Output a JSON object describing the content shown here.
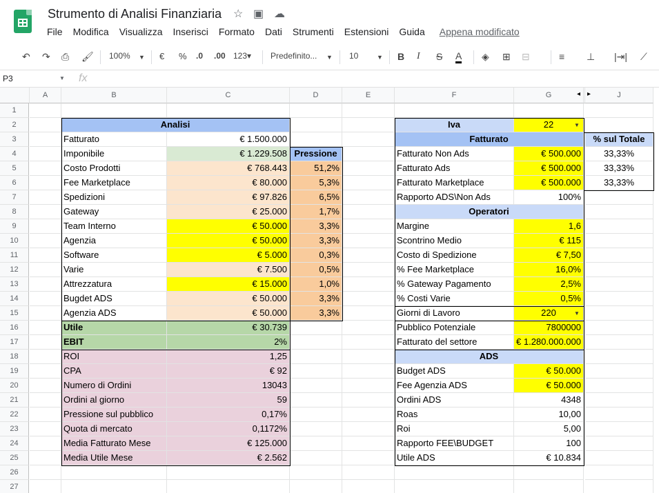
{
  "app": {
    "title": "Strumento di Analisi Finanziaria",
    "last_edit": "Appena modificato"
  },
  "menu": [
    "File",
    "Modifica",
    "Visualizza",
    "Inserisci",
    "Formato",
    "Dati",
    "Strumenti",
    "Estensioni",
    "Guida"
  ],
  "toolbar": {
    "zoom": "100%",
    "currency": "€",
    "percent": "%",
    "dec_decimal": ".0",
    "inc_decimal": ".00",
    "more_formats": "123▾",
    "font": "Predefinito...",
    "font_size": "10"
  },
  "formula": {
    "cell_ref": "P3"
  },
  "colors": {
    "header_blue": "#a4c2f4",
    "light_green": "#d9ead3",
    "green": "#b6d7a8",
    "peach": "#fce5cd",
    "orange": "#f9cb9c",
    "yellow": "#ffff00",
    "pink": "#ead1dc"
  },
  "columns": [
    "A",
    "B",
    "C",
    "D",
    "E",
    "F",
    "G",
    "H",
    "J"
  ],
  "rows": [
    {
      "n": 1,
      "cells": []
    },
    {
      "n": 2,
      "cells": [
        {
          "c": "B",
          "span": 2,
          "v": "Analisi",
          "a": "c",
          "b": true,
          "bg": "#a4c2f4"
        },
        {
          "c": "F",
          "v": "Iva",
          "a": "c",
          "b": true,
          "bg": "#c9daf8"
        },
        {
          "c": "G",
          "v": "22",
          "a": "c",
          "bg": "#ffff00",
          "dd": true
        }
      ]
    },
    {
      "n": 3,
      "cells": [
        {
          "c": "B",
          "v": "Fatturato"
        },
        {
          "c": "C",
          "v": "€ 1.500.000",
          "a": "r"
        },
        {
          "c": "F",
          "span": 2,
          "v": "Fatturato",
          "a": "c",
          "b": true,
          "bg": "#a4c2f4"
        },
        {
          "c": "J",
          "v": "% sul Totale",
          "a": "c",
          "b": true,
          "bg": "#c9daf8"
        }
      ]
    },
    {
      "n": 4,
      "cells": [
        {
          "c": "B",
          "v": "Imponibile"
        },
        {
          "c": "C",
          "v": "€ 1.229.508",
          "a": "r",
          "bg": "#d9ead3"
        },
        {
          "c": "D",
          "v": "Pressione",
          "a": "c",
          "b": true,
          "bg": "#a4c2f4"
        },
        {
          "c": "F",
          "v": "Fatturato Non Ads"
        },
        {
          "c": "G",
          "v": "€ 500.000",
          "a": "r",
          "bg": "#ffff00"
        },
        {
          "c": "J",
          "v": "33,33%",
          "a": "c"
        }
      ]
    },
    {
      "n": 5,
      "cells": [
        {
          "c": "B",
          "v": "Costo Prodotti"
        },
        {
          "c": "C",
          "v": "€ 768.443",
          "a": "r",
          "bg": "#fce5cd"
        },
        {
          "c": "D",
          "v": "51,2%",
          "a": "r",
          "bg": "#f9cb9c"
        },
        {
          "c": "F",
          "v": "Fatturato Ads"
        },
        {
          "c": "G",
          "v": "€ 500.000",
          "a": "r",
          "bg": "#ffff00"
        },
        {
          "c": "J",
          "v": "33,33%",
          "a": "c"
        }
      ]
    },
    {
      "n": 6,
      "cells": [
        {
          "c": "B",
          "v": "Fee Marketplace"
        },
        {
          "c": "C",
          "v": "€ 80.000",
          "a": "r",
          "bg": "#fce5cd"
        },
        {
          "c": "D",
          "v": "5,3%",
          "a": "r",
          "bg": "#f9cb9c"
        },
        {
          "c": "F",
          "v": "Fatturato Marketplace"
        },
        {
          "c": "G",
          "v": "€ 500.000",
          "a": "r",
          "bg": "#ffff00"
        },
        {
          "c": "J",
          "v": "33,33%",
          "a": "c"
        }
      ]
    },
    {
      "n": 7,
      "cells": [
        {
          "c": "B",
          "v": "Spedizioni"
        },
        {
          "c": "C",
          "v": "€ 97.826",
          "a": "r",
          "bg": "#fce5cd"
        },
        {
          "c": "D",
          "v": "6,5%",
          "a": "r",
          "bg": "#f9cb9c"
        },
        {
          "c": "F",
          "v": "Rapporto ADS\\Non Ads"
        },
        {
          "c": "G",
          "v": "100%",
          "a": "r"
        }
      ]
    },
    {
      "n": 8,
      "cells": [
        {
          "c": "B",
          "v": "Gateway"
        },
        {
          "c": "C",
          "v": "€ 25.000",
          "a": "r",
          "bg": "#fce5cd"
        },
        {
          "c": "D",
          "v": "1,7%",
          "a": "r",
          "bg": "#f9cb9c"
        },
        {
          "c": "F",
          "span": 2,
          "v": "Operatori",
          "a": "c",
          "b": true,
          "bg": "#c9daf8"
        }
      ]
    },
    {
      "n": 9,
      "cells": [
        {
          "c": "B",
          "v": "Team Interno"
        },
        {
          "c": "C",
          "v": "€ 50.000",
          "a": "r",
          "bg": "#ffff00"
        },
        {
          "c": "D",
          "v": "3,3%",
          "a": "r",
          "bg": "#f9cb9c"
        },
        {
          "c": "F",
          "v": "Margine"
        },
        {
          "c": "G",
          "v": "1,6",
          "a": "r",
          "bg": "#ffff00"
        }
      ]
    },
    {
      "n": 10,
      "cells": [
        {
          "c": "B",
          "v": "Agenzia"
        },
        {
          "c": "C",
          "v": "€ 50.000",
          "a": "r",
          "bg": "#ffff00"
        },
        {
          "c": "D",
          "v": "3,3%",
          "a": "r",
          "bg": "#f9cb9c"
        },
        {
          "c": "F",
          "v": "Scontrino Medio"
        },
        {
          "c": "G",
          "v": "€ 115",
          "a": "r",
          "bg": "#ffff00"
        }
      ]
    },
    {
      "n": 11,
      "cells": [
        {
          "c": "B",
          "v": "Software"
        },
        {
          "c": "C",
          "v": "€ 5.000",
          "a": "r",
          "bg": "#ffff00"
        },
        {
          "c": "D",
          "v": "0,3%",
          "a": "r",
          "bg": "#f9cb9c"
        },
        {
          "c": "F",
          "v": "Costo di Spedizione"
        },
        {
          "c": "G",
          "v": "€ 7,50",
          "a": "r",
          "bg": "#ffff00"
        }
      ]
    },
    {
      "n": 12,
      "cells": [
        {
          "c": "B",
          "v": "Varie"
        },
        {
          "c": "C",
          "v": "€ 7.500",
          "a": "r",
          "bg": "#fce5cd"
        },
        {
          "c": "D",
          "v": "0,5%",
          "a": "r",
          "bg": "#f9cb9c"
        },
        {
          "c": "F",
          "v": "% Fee Marketplace"
        },
        {
          "c": "G",
          "v": "16,0%",
          "a": "r",
          "bg": "#ffff00"
        }
      ]
    },
    {
      "n": 13,
      "cells": [
        {
          "c": "B",
          "v": "Attrezzatura"
        },
        {
          "c": "C",
          "v": "€ 15.000",
          "a": "r",
          "bg": "#ffff00"
        },
        {
          "c": "D",
          "v": "1,0%",
          "a": "r",
          "bg": "#f9cb9c"
        },
        {
          "c": "F",
          "v": "% Gateway Pagamento"
        },
        {
          "c": "G",
          "v": "2,5%",
          "a": "r",
          "bg": "#ffff00"
        }
      ]
    },
    {
      "n": 14,
      "cells": [
        {
          "c": "B",
          "v": "Bugdet ADS"
        },
        {
          "c": "C",
          "v": "€ 50.000",
          "a": "r",
          "bg": "#fce5cd"
        },
        {
          "c": "D",
          "v": "3,3%",
          "a": "r",
          "bg": "#f9cb9c"
        },
        {
          "c": "F",
          "v": "% Costi Varie"
        },
        {
          "c": "G",
          "v": "0,5%",
          "a": "r",
          "bg": "#ffff00"
        }
      ]
    },
    {
      "n": 15,
      "cells": [
        {
          "c": "B",
          "v": "Agenzia ADS"
        },
        {
          "c": "C",
          "v": "€ 50.000",
          "a": "r",
          "bg": "#fce5cd"
        },
        {
          "c": "D",
          "v": "3,3%",
          "a": "r",
          "bg": "#f9cb9c"
        },
        {
          "c": "F",
          "v": "Giorni di Lavoro"
        },
        {
          "c": "G",
          "v": "220",
          "a": "c",
          "bg": "#ffff00",
          "dd": true
        }
      ]
    },
    {
      "n": 16,
      "cells": [
        {
          "c": "B",
          "v": "Utile",
          "b": true,
          "bg": "#b6d7a8"
        },
        {
          "c": "C",
          "v": "€ 30.739",
          "a": "r",
          "bg": "#b6d7a8"
        },
        {
          "c": "F",
          "v": "Pubblico Potenziale"
        },
        {
          "c": "G",
          "v": "7800000",
          "a": "r",
          "bg": "#ffff00"
        }
      ]
    },
    {
      "n": 17,
      "cells": [
        {
          "c": "B",
          "v": "EBIT",
          "b": true,
          "bg": "#b6d7a8"
        },
        {
          "c": "C",
          "v": "2%",
          "a": "r",
          "bg": "#b6d7a8"
        },
        {
          "c": "F",
          "v": "Fatturato del settore"
        },
        {
          "c": "G",
          "v": "€ 1.280.000.000",
          "a": "r",
          "bg": "#ffff00"
        }
      ]
    },
    {
      "n": 18,
      "cells": [
        {
          "c": "B",
          "v": "ROI",
          "bg": "#ead1dc"
        },
        {
          "c": "C",
          "v": "1,25",
          "a": "r",
          "bg": "#ead1dc"
        },
        {
          "c": "F",
          "span": 2,
          "v": "ADS",
          "a": "c",
          "b": true,
          "bg": "#c9daf8"
        }
      ]
    },
    {
      "n": 19,
      "cells": [
        {
          "c": "B",
          "v": "CPA",
          "bg": "#ead1dc"
        },
        {
          "c": "C",
          "v": "€ 92",
          "a": "r",
          "bg": "#ead1dc"
        },
        {
          "c": "F",
          "v": "Budget ADS"
        },
        {
          "c": "G",
          "v": "€ 50.000",
          "a": "r",
          "bg": "#ffff00"
        }
      ]
    },
    {
      "n": 20,
      "cells": [
        {
          "c": "B",
          "v": "Numero di Ordini",
          "bg": "#ead1dc"
        },
        {
          "c": "C",
          "v": "13043",
          "a": "r",
          "bg": "#ead1dc"
        },
        {
          "c": "F",
          "v": "Fee Agenzia ADS"
        },
        {
          "c": "G",
          "v": "€ 50.000",
          "a": "r",
          "bg": "#ffff00"
        }
      ]
    },
    {
      "n": 21,
      "cells": [
        {
          "c": "B",
          "v": "Ordini al giorno",
          "bg": "#ead1dc"
        },
        {
          "c": "C",
          "v": "59",
          "a": "r",
          "bg": "#ead1dc"
        },
        {
          "c": "F",
          "v": "Ordini ADS"
        },
        {
          "c": "G",
          "v": "4348",
          "a": "r"
        }
      ]
    },
    {
      "n": 22,
      "cells": [
        {
          "c": "B",
          "v": "Pressione sul pubblico",
          "bg": "#ead1dc"
        },
        {
          "c": "C",
          "v": "0,17%",
          "a": "r",
          "bg": "#ead1dc"
        },
        {
          "c": "F",
          "v": "Roas"
        },
        {
          "c": "G",
          "v": "10,00",
          "a": "r"
        }
      ]
    },
    {
      "n": 23,
      "cells": [
        {
          "c": "B",
          "v": "Quota di mercato",
          "bg": "#ead1dc"
        },
        {
          "c": "C",
          "v": "0,1172%",
          "a": "r",
          "bg": "#ead1dc"
        },
        {
          "c": "F",
          "v": "Roi"
        },
        {
          "c": "G",
          "v": "5,00",
          "a": "r"
        }
      ]
    },
    {
      "n": 24,
      "cells": [
        {
          "c": "B",
          "v": "Media Fatturato Mese",
          "bg": "#ead1dc"
        },
        {
          "c": "C",
          "v": "€ 125.000",
          "a": "r",
          "bg": "#ead1dc"
        },
        {
          "c": "F",
          "v": "Rapporto FEE\\BUDGET"
        },
        {
          "c": "G",
          "v": "100",
          "a": "r"
        }
      ]
    },
    {
      "n": 25,
      "cells": [
        {
          "c": "B",
          "v": "Media Utile Mese",
          "bg": "#ead1dc"
        },
        {
          "c": "C",
          "v": "€ 2.562",
          "a": "r",
          "bg": "#ead1dc"
        },
        {
          "c": "F",
          "v": "Utile ADS"
        },
        {
          "c": "G",
          "v": "€ 10.834",
          "a": "r"
        }
      ]
    },
    {
      "n": 26,
      "cells": []
    },
    {
      "n": 27,
      "cells": []
    }
  ]
}
